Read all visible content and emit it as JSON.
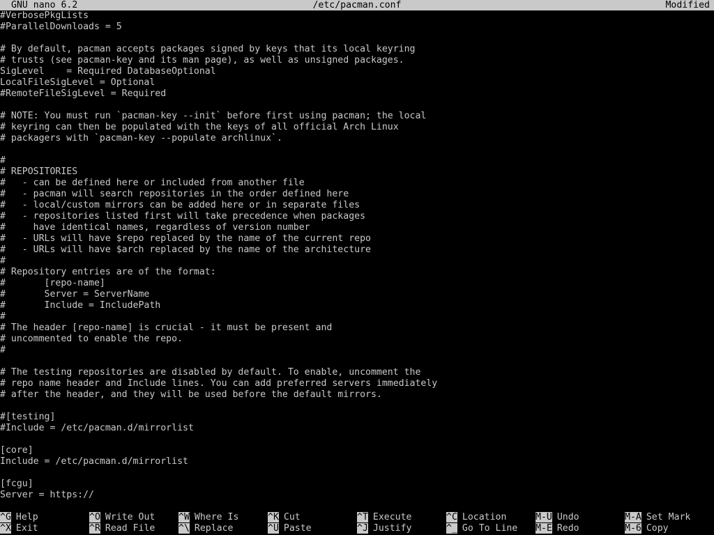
{
  "titlebar": {
    "app": "GNU nano 6.2",
    "file": "/etc/pacman.conf",
    "status": "Modified"
  },
  "editor": {
    "lines": [
      "#VerbosePkgLists",
      "#ParallelDownloads = 5",
      "",
      "# By default, pacman accepts packages signed by keys that its local keyring",
      "# trusts (see pacman-key and its man page), as well as unsigned packages.",
      "SigLevel    = Required DatabaseOptional",
      "LocalFileSigLevel = Optional",
      "#RemoteFileSigLevel = Required",
      "",
      "# NOTE: You must run `pacman-key --init` before first using pacman; the local",
      "# keyring can then be populated with the keys of all official Arch Linux",
      "# packagers with `pacman-key --populate archlinux`.",
      "",
      "#",
      "# REPOSITORIES",
      "#   - can be defined here or included from another file",
      "#   - pacman will search repositories in the order defined here",
      "#   - local/custom mirrors can be added here or in separate files",
      "#   - repositories listed first will take precedence when packages",
      "#     have identical names, regardless of version number",
      "#   - URLs will have $repo replaced by the name of the current repo",
      "#   - URLs will have $arch replaced by the name of the architecture",
      "#",
      "# Repository entries are of the format:",
      "#       [repo-name]",
      "#       Server = ServerName",
      "#       Include = IncludePath",
      "#",
      "# The header [repo-name] is crucial - it must be present and",
      "# uncommented to enable the repo.",
      "#",
      "",
      "# The testing repositories are disabled by default. To enable, uncomment the",
      "# repo name header and Include lines. You can add preferred servers immediately",
      "# after the header, and they will be used before the default mirrors.",
      "",
      "#[testing]",
      "#Include = /etc/pacman.d/mirrorlist",
      "",
      "[core]",
      "Include = /etc/pacman.d/mirrorlist",
      "",
      "[fcgu]",
      "Server = https://"
    ]
  },
  "shortcuts": {
    "row1": [
      {
        "key": "^G",
        "label": "Help"
      },
      {
        "key": "^O",
        "label": "Write Out"
      },
      {
        "key": "^W",
        "label": "Where Is"
      },
      {
        "key": "^K",
        "label": "Cut"
      },
      {
        "key": "^T",
        "label": "Execute"
      },
      {
        "key": "^C",
        "label": "Location"
      },
      {
        "key": "M-U",
        "label": "Undo"
      },
      {
        "key": "M-A",
        "label": "Set Mark"
      }
    ],
    "row2": [
      {
        "key": "^X",
        "label": "Exit"
      },
      {
        "key": "^R",
        "label": "Read File"
      },
      {
        "key": "^\\",
        "label": "Replace"
      },
      {
        "key": "^U",
        "label": "Paste"
      },
      {
        "key": "^J",
        "label": "Justify"
      },
      {
        "key": "^_",
        "label": "Go To Line"
      },
      {
        "key": "M-E",
        "label": "Redo"
      },
      {
        "key": "M-6",
        "label": "Copy"
      }
    ]
  }
}
